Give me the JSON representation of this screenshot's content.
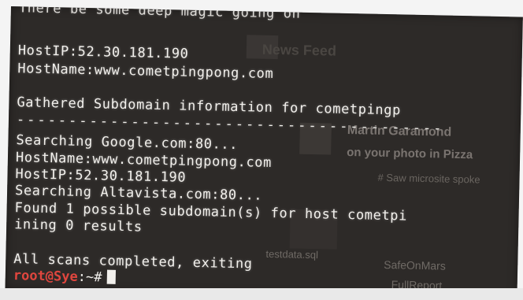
{
  "terminal": {
    "lines": [
      "There be some deep magic going on",
      "HostIP:52.30.181.190",
      "HostName:www.cometpingpong.com",
      "Gathered Subdomain information for cometpingp",
      "-----------------------------------------",
      "Searching Google.com:80...",
      "HostName:www.cometpingpong.com",
      "HostIP:52.30.181.190",
      "Searching Altavista.com:80...",
      "Found 1 possible subdomain(s) for host cometpi",
      "ining 0 results",
      "All scans completed, exiting"
    ],
    "prompt_user": "root@Sye",
    "prompt_path": ":~#",
    "colors": {
      "text": "#f2f0ec",
      "prompt": "#e0463e",
      "background": "#2d2a28"
    }
  },
  "background_desktop": {
    "title": "News Feed",
    "notification": "Martin Garamond",
    "notification_sub": "on your photo in Pizza",
    "link": "# Saw microsite spoke",
    "files": [
      "testdata.sql",
      "SafeOnMars",
      "FullReport"
    ]
  }
}
